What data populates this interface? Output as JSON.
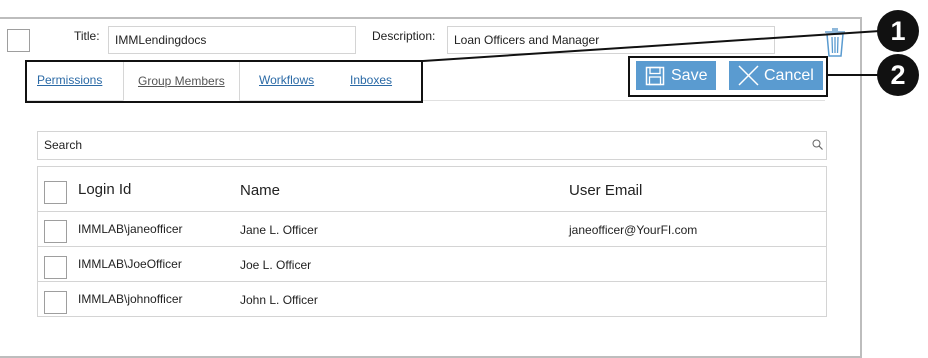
{
  "form": {
    "title_label": "Title:",
    "title_value": "IMMLendingdocs",
    "description_label": "Description:",
    "description_value": "Loan Officers and Manager"
  },
  "tabs": [
    {
      "label": "Permissions"
    },
    {
      "label": "Group Members"
    },
    {
      "label": "Workflows"
    },
    {
      "label": "Inboxes"
    }
  ],
  "actions": {
    "save_label": "Save",
    "cancel_label": "Cancel"
  },
  "callouts": [
    "1",
    "2"
  ],
  "search": {
    "placeholder": "Search"
  },
  "table": {
    "columns": [
      "Login Id",
      "Name",
      "User Email"
    ],
    "rows": [
      {
        "login": "IMMLAB\\janeofficer",
        "name": "Jane L. Officer",
        "email": "janeofficer@YourFI.com"
      },
      {
        "login": "IMMLAB\\JoeOfficer",
        "name": "Joe L. Officer",
        "email": ""
      },
      {
        "login": "IMMLAB\\johnofficer",
        "name": "John L. Officer",
        "email": ""
      }
    ]
  },
  "colors": {
    "accent_button": "#5a9bd0",
    "tab_link": "#2b6aa6",
    "callout": "#111111"
  }
}
